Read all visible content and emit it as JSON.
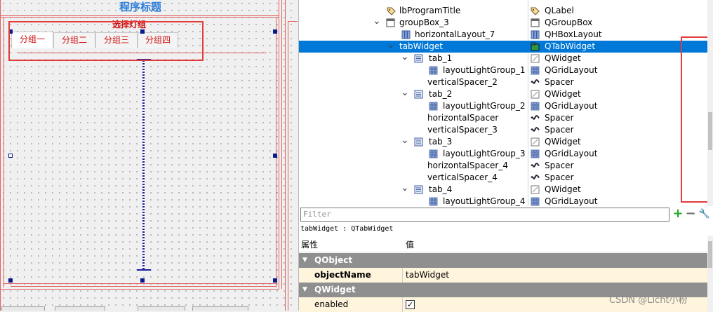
{
  "canvas": {
    "program_title": "程序标题",
    "group_title": "选择灯组",
    "tabs": [
      "分组一",
      "分组二",
      "分组三",
      "分组四"
    ]
  },
  "tree": {
    "rows": [
      {
        "name": "lbProgramTitle",
        "cls": "QLabel",
        "icon": "label-icon"
      },
      {
        "name": "groupBox_3",
        "cls": "QGroupBox",
        "icon": "groupbox-icon"
      },
      {
        "name": "horizontalLayout_7",
        "cls": "QHBoxLayout",
        "icon": "hbox-layout-icon"
      },
      {
        "name": "tabWidget",
        "cls": "QTabWidget",
        "icon": "tabwidget-icon"
      },
      {
        "name": "tab_1",
        "cls": "QWidget",
        "icon": "widget-icon"
      },
      {
        "name": "layoutLightGroup_1",
        "cls": "QGridLayout",
        "icon": "grid-layout-icon"
      },
      {
        "name": "verticalSpacer_2",
        "cls": "Spacer",
        "icon": "spacer-icon"
      },
      {
        "name": "tab_2",
        "cls": "QWidget",
        "icon": "widget-icon"
      },
      {
        "name": "layoutLightGroup_2",
        "cls": "QGridLayout",
        "icon": "grid-layout-icon"
      },
      {
        "name": "horizontalSpacer",
        "cls": "Spacer",
        "icon": "spacer-icon"
      },
      {
        "name": "verticalSpacer_3",
        "cls": "Spacer",
        "icon": "spacer-icon"
      },
      {
        "name": "tab_3",
        "cls": "QWidget",
        "icon": "widget-icon"
      },
      {
        "name": "layoutLightGroup_3",
        "cls": "QGridLayout",
        "icon": "grid-layout-icon"
      },
      {
        "name": "horizontalSpacer_4",
        "cls": "Spacer",
        "icon": "spacer-icon"
      },
      {
        "name": "verticalSpacer_4",
        "cls": "Spacer",
        "icon": "spacer-icon"
      },
      {
        "name": "tab_4",
        "cls": "QWidget",
        "icon": "widget-icon"
      },
      {
        "name": "layoutLightGroup_4",
        "cls": "QGridLayout",
        "icon": "grid-layout-icon"
      }
    ],
    "selected": "tabWidget"
  },
  "props": {
    "filter_placeholder": "Filter",
    "class_line": "tabWidget : QTabWidget",
    "header_property": "属性",
    "header_value": "值",
    "categories": [
      {
        "label": "QObject",
        "rows": [
          {
            "name": "objectName",
            "value": "tabWidget"
          }
        ]
      },
      {
        "label": "QWidget",
        "rows": [
          {
            "name": "enabled",
            "value": "checked"
          }
        ]
      }
    ],
    "plus": "+",
    "minus": "−",
    "wrench": "🔧"
  },
  "watermark": "CSDN @Licht小粉",
  "colors": {
    "accent": "#0078d7",
    "highlight": "#e33b3b",
    "tab_text": "#d01010",
    "title": "#2f7fd8"
  }
}
